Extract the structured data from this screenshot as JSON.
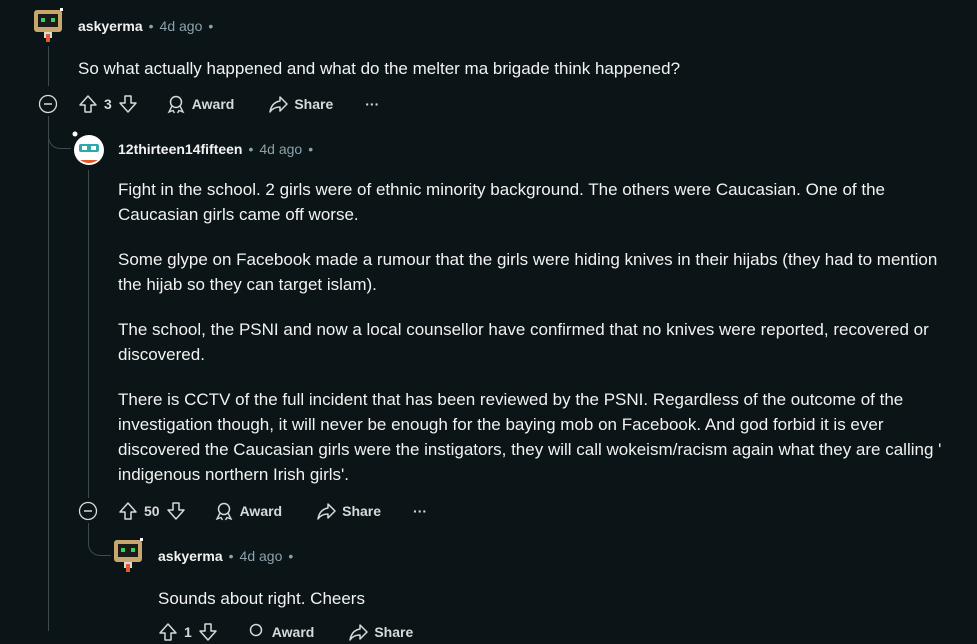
{
  "comments": [
    {
      "author": "askyerma",
      "sep1": "•",
      "time": "4d ago",
      "sep2": "•",
      "paragraphs": [
        "So what actually happened and what do the melter ma brigade think happened?"
      ],
      "votes": "3",
      "award_label": "Award",
      "share_label": "Share",
      "more_label": "···"
    },
    {
      "author": "12thirteen14fifteen",
      "sep1": "•",
      "time": "4d ago",
      "sep2": "•",
      "paragraphs": [
        "Fight in the school. 2 girls were of ethnic minority background. The others were Caucasian. One of the Caucasian girls came off worse.",
        "Some glype on Facebook made a rumour that the girls were hiding knives in their hijabs (they had to mention the hijab so they can target islam).",
        "The school, the PSNI and now a local counsellor have confirmed that no knives were reported, recovered or discovered.",
        "There is CCTV of the full incident that has been reviewed by the PSNI. Regardless of the outcome of the investigation though, it will never be enough for the baying mob on Facebook. And god forbid it is ever discovered the Caucasian girls were the instigators, they will call wokeism/racism again what they are calling ' indigenous northern Irish girls'."
      ],
      "votes": "50",
      "award_label": "Award",
      "share_label": "Share",
      "more_label": "···"
    },
    {
      "author": "askyerma",
      "sep1": "•",
      "time": "4d ago",
      "sep2": "•",
      "paragraphs": [
        "Sounds about right. Cheers"
      ],
      "votes": "1",
      "award_label": "Award",
      "share_label": "Share"
    }
  ],
  "icons": {
    "upvote": "upvote-arrow-icon",
    "downvote": "downvote-arrow-icon",
    "award": "award-medal-icon",
    "share": "share-arrow-icon",
    "collapse": "collapse-minus-icon",
    "more": "more-dots-icon"
  },
  "colors": {
    "background": "#0b1416",
    "text": "#f2f2f2",
    "meta": "#8ba2ad",
    "thread_line": "#3e4a4f"
  }
}
